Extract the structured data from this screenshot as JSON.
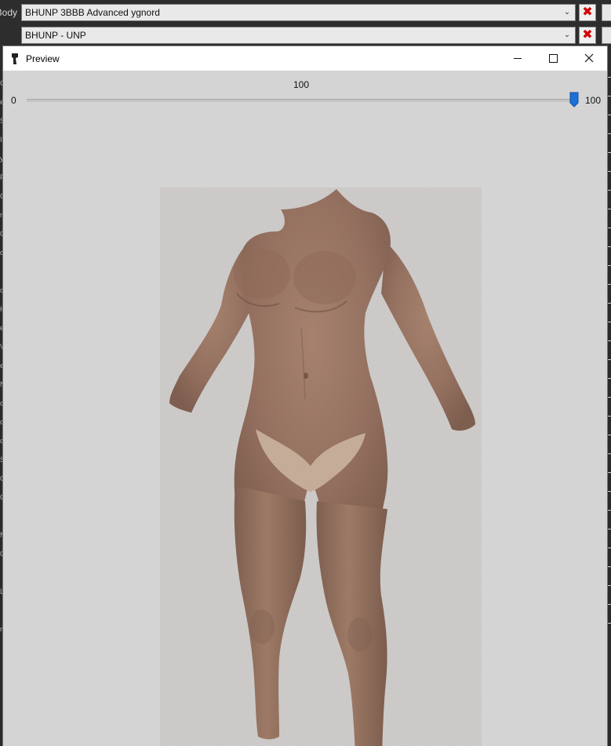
{
  "background_app": {
    "body_row": {
      "label": "Body",
      "combo_value": "BHUNP 3BBB Advanced ygnord"
    },
    "preset_row": {
      "label": "",
      "combo_value": "BHUNP - UNP"
    },
    "left_strip_chars": [
      "C",
      "e",
      "S",
      "I",
      "y",
      "F",
      "C",
      "r",
      "G",
      "o",
      "",
      "o",
      "H",
      "e",
      "V",
      "e",
      "N",
      "c",
      "d",
      "c",
      "S",
      "G",
      "G",
      "",
      "N",
      "O",
      "",
      "L",
      "",
      "ri"
    ]
  },
  "preview_window": {
    "title": "Preview",
    "icon": "app-logo-icon",
    "controls": [
      "minimize-icon",
      "maximize-icon",
      "close-icon"
    ],
    "slider": {
      "min_label": "0",
      "max_label": "100",
      "current_label": "100",
      "value": 100,
      "min": 0,
      "max": 100
    },
    "viewport_background": "#d4d4d4",
    "model": "3d-body-mesh"
  },
  "colors": {
    "close_x": "#d40000",
    "slider_thumb": "#1e6fd6",
    "skin": "#9b7560"
  }
}
